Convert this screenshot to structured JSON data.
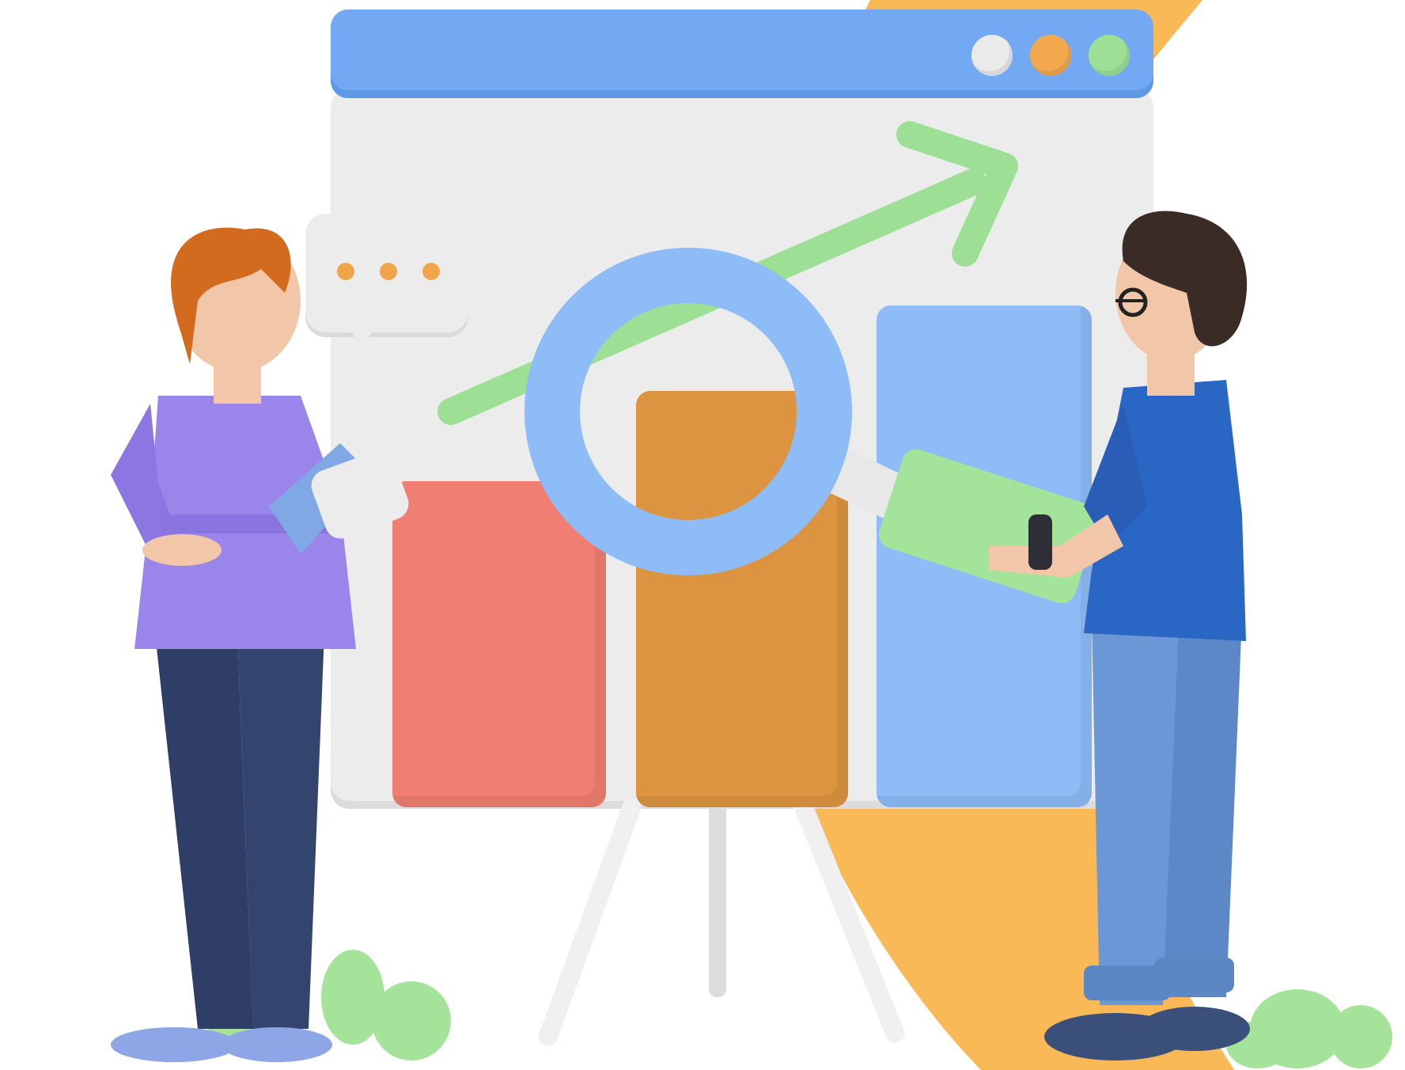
{
  "scene": {
    "description_free": true
  },
  "colors": {
    "background": "#ffffff",
    "accent_orange": "#f9b956",
    "board_panel": "#ececec",
    "titlebar_blue": "#72a9f2",
    "bar_red": "#f07e72",
    "bar_orange": "#dc9440",
    "bar_blue": "#8ebcf6",
    "arrow_green": "#9de095",
    "magnifier_blue": "#8ebcf6",
    "shrub_green": "#a6e39a"
  },
  "icons": {
    "window_controls": [
      "close-dot",
      "minimize-dot",
      "maximize-dot"
    ],
    "speech_bubble": "ellipsis-icon",
    "trend_arrow": "trend-up-arrow-icon",
    "magnifier": "magnifying-glass-icon"
  }
}
